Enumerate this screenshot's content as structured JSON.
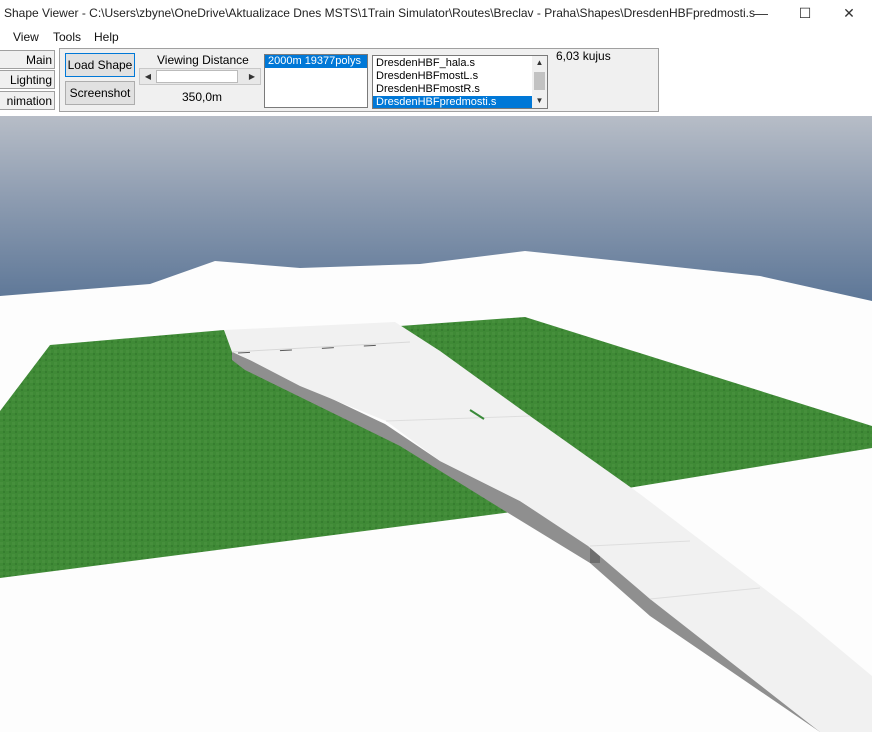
{
  "window": {
    "title": "Shape Viewer - C:\\Users\\zbyne\\OneDrive\\Aktualizace Dnes MSTS\\1Train Simulator\\Routes\\Breclav - Praha\\Shapes\\DresdenHBFpredmosti.s",
    "minimize_glyph": "—",
    "maximize_glyph": "☐",
    "close_glyph": "✕"
  },
  "menu": [
    "View",
    "Tools",
    "Help"
  ],
  "side_tabs": [
    "Main",
    "Lighting",
    "nimation"
  ],
  "toolbar": {
    "load_shape": "Load Shape",
    "screenshot": "Screenshot",
    "viewing_distance_label": "Viewing Distance",
    "viewing_distance_value": "350,0m",
    "lod_list": [
      "2000m 19377polys"
    ],
    "shape_list": [
      "DresdenHBF_hala.s",
      "DresdenHBFmostL.s",
      "DresdenHBFmostR.s",
      "DresdenHBFpredmosti.s"
    ],
    "selected_shape": "DresdenHBFpredmosti.s",
    "fps_text": "6,03 kujus"
  },
  "icons": {
    "scroll_left": "scroll-left-icon",
    "scroll_right": "scroll-right-icon",
    "scroll_up": "scroll-up-icon",
    "scroll_down": "scroll-down-icon"
  },
  "colors": {
    "selection": "#0078d7",
    "grass": "#3f8a36",
    "sky_top": "#aeb6c2",
    "sky_horizon": "#5c7597",
    "track_bed": "#f1f1f1",
    "wall": "#8e8e8e"
  }
}
